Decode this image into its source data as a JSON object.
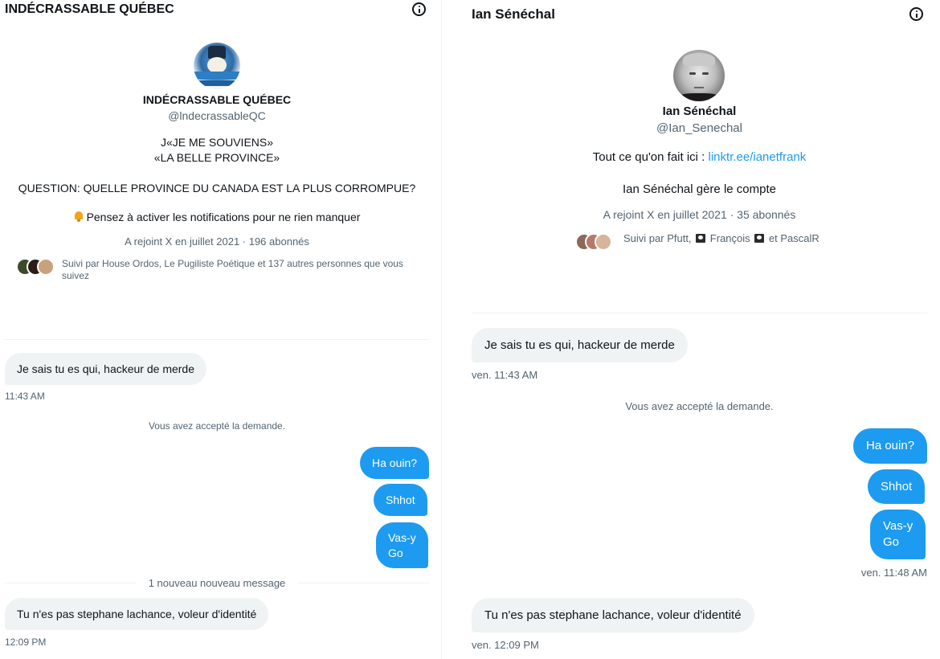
{
  "left": {
    "title": "INDÉCRASSABLE QUÉBEC",
    "profile": {
      "name": "INDÉCRASSABLE QUÉBEC",
      "handle": "@lndecrassableQC",
      "bio_line1": "J«JE ME SOUVIENS»",
      "bio_line2": "«LA BELLE PROVINCE»",
      "bio_line3": "QUESTION: QUELLE PROVINCE DU CANADA EST LA PLUS CORROMPUE?",
      "bio_line4": "Pensez à activer les notifications pour ne rien manquer",
      "meta": "A rejoint X en juillet 2021 · 196 abonnés",
      "followed_line1": "Suivi par House Ordos, Le Pugiliste Poétique et 137 autres personnes que vous",
      "followed_line2": "suivez"
    },
    "messages": {
      "m1": "Je sais tu es qui, hackeur de merde",
      "m1_time": "11:43 AM",
      "system": "Vous avez accepté la demande.",
      "out1": "Ha ouin?",
      "out2": "Shhot",
      "out3_line1": "Vas-y",
      "out3_line2": "Go",
      "new_divider": "1 nouveau nouveau message",
      "m2": "Tu n'es pas stephane lachance, voleur d'identité",
      "m2_time": "12:09 PM"
    }
  },
  "right": {
    "title": "Ian Sénéchal",
    "profile": {
      "name": "Ian Sénéchal",
      "handle": "@Ian_Senechal",
      "bio_prefix": "Tout ce qu'on fait ici : ",
      "bio_link": "linktr.ee/ianetfrank",
      "managed": "Ian Sénéchal gère le compte",
      "meta": "A rejoint X en juillet 2021 · 35 abonnés",
      "followed_a": "Suivi par Pfutt,",
      "followed_b": "François",
      "followed_c": "et PascalR"
    },
    "messages": {
      "m1": "Je sais tu es qui, hackeur de merde",
      "m1_time": "ven. 11:43 AM",
      "system": "Vous avez accepté la demande.",
      "out1": "Ha ouin?",
      "out2": "Shhot",
      "out3_line1": "Vas-y",
      "out3_line2": "Go",
      "out_time": "ven. 11:48 AM",
      "m2": "Tu n'es pas stephane lachance, voleur d'identité",
      "m2_time": "ven. 12:09 PM"
    }
  },
  "colors": {
    "accent": "#1d9bf0",
    "incoming_bubble": "#eff3f4",
    "secondary_text": "#536471",
    "primary_text": "#0f1419"
  },
  "icons": [
    "info-icon",
    "bell-icon",
    "pirate-flag-icon"
  ]
}
